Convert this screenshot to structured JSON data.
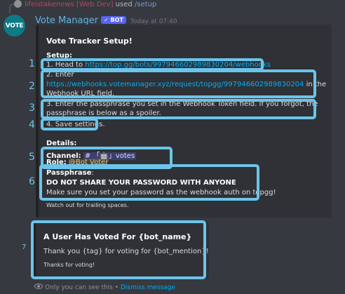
{
  "reply": {
    "user": "lifeistakenews [Web Dev]",
    "action": "used",
    "command": "/setup"
  },
  "avatar_text": "VOTE",
  "header": {
    "bot_name": "Vote Manager",
    "bot_tag": "✓ BOT",
    "timestamp": "Today at 07:40"
  },
  "setup_embed": {
    "title": "Vote Tracker Setup!",
    "setup_label": "Setup:",
    "step1_prefix": "1. Head to ",
    "step1_link": "https://top.gg/bots/997946602989830204/webhooks",
    "step2_prefix": "2. Enter",
    "step2_link": "https://webhooks.votemanager.xyz/request/topgg/997946602989830204",
    "step2_suffix": " in the",
    "step2_line2": "Webhook URL field.",
    "step3_line1": "3. Enter the passphrase you set in the Webhook Token field. If you forgot, the",
    "step3_line2": "passphrase is below as a spoiler.",
    "step4": "4. Save settings.",
    "details_label": "Details:",
    "channel_label": "Channel:",
    "channel_value": "# 「🤖」votes",
    "role_label": "Role:",
    "role_value": "@Bot Voter",
    "passphrase_label": "Passphrase",
    "passphrase_colon": ":",
    "warning": "DO NOT SHARE YOUR PASSWORD WITH ANYONE",
    "advice": "Make sure you set your password as the webhook auth on topgg!",
    "footer": "Watch out for trailing spaces."
  },
  "vote_embed": {
    "title": "A User Has Voted For {bot_name}",
    "description": "Thank you {tag} for voting for {bot_mention}!",
    "footer": "Thanks for voting!"
  },
  "ephemeral": {
    "notice": "Only you can see this • ",
    "dismiss": "Dismiss message"
  },
  "annotations": [
    "1",
    "2",
    "3",
    "4",
    "5",
    "6",
    "7"
  ],
  "colors": {
    "background": "#36393f",
    "embed": "#2f3136",
    "link": "#00b0f4",
    "annotation": "#6cc4ea",
    "bot_tag": "#5865f2"
  }
}
